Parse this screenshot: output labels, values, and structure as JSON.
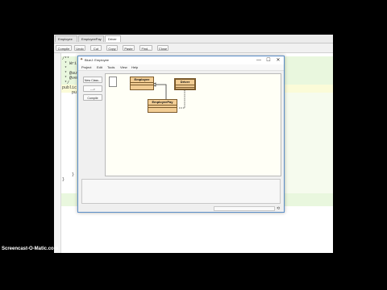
{
  "editor": {
    "tabs": [
      {
        "label": "Employee",
        "close": "×"
      },
      {
        "label": "EmployeePay",
        "close": "×"
      },
      {
        "label": "Driver",
        "close": "×"
      }
    ],
    "toolbar": [
      "Compile",
      "Undo",
      "Cut",
      "Copy",
      "Paste",
      "Find...",
      "Close"
    ],
    "code_lines": [
      "/**",
      " * Wri",
      " *",
      " * @aut",
      " * @ver",
      " */",
      "public",
      "    pu",
      "",
      "",
      "",
      "",
      "",
      "",
      "",
      "",
      "",
      "",
      "",
      "",
      "",
      "",
      "",
      "",
      "    }",
      "}"
    ]
  },
  "dialog": {
    "title": "BlueJ: Employee",
    "menus": [
      "Project",
      "Edit",
      "Tools",
      "View",
      "Help"
    ],
    "buttons": {
      "new_class": "New Class...",
      "arrow": "--->",
      "compile": "Compile"
    },
    "classes": [
      {
        "name": "Employee"
      },
      {
        "name": "Driver"
      },
      {
        "name": "EmployeePay"
      }
    ],
    "window_controls": {
      "minimize": "—",
      "maximize": "☐",
      "close": "✕"
    }
  },
  "watermark": "Screencast-O-Matic.com",
  "colors": {
    "class_fill": "#f2cd94",
    "canvas": "#fffff6",
    "editor_band": "#e9f7de",
    "highlight": "#fbfbd8"
  }
}
